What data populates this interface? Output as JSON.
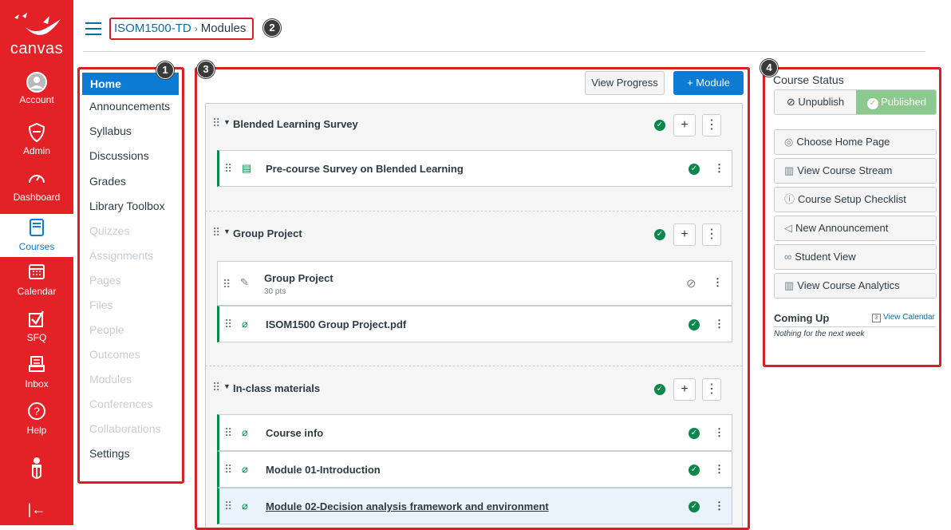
{
  "brand": {
    "wordmark": "canvas",
    "primary": "#e42127",
    "accent": "#0b7bd3",
    "published_green": "#0b874b"
  },
  "global_nav": [
    {
      "label": "Account",
      "icon": "account-avatar-icon"
    },
    {
      "label": "Admin",
      "icon": "shield-icon"
    },
    {
      "label": "Dashboard",
      "icon": "dashboard-gauge-icon"
    },
    {
      "label": "Courses",
      "icon": "courses-book-icon"
    },
    {
      "label": "Calendar",
      "icon": "calendar-icon"
    },
    {
      "label": "SFQ",
      "icon": "checkbox-icon"
    },
    {
      "label": "Inbox",
      "icon": "inbox-icon"
    },
    {
      "label": "Help",
      "icon": "help-icon"
    }
  ],
  "breadcrumb": {
    "course": "ISOM1500-TD",
    "sep": "›",
    "page": "Modules"
  },
  "callouts": [
    "1",
    "2",
    "3",
    "4"
  ],
  "course_nav": {
    "active": "Home",
    "items": [
      "Announcements",
      "Syllabus",
      "Discussions",
      "Grades",
      "Library Toolbox"
    ],
    "disabled": [
      "Quizzes",
      "Assignments",
      "Pages",
      "Files",
      "People",
      "Outcomes",
      "Modules",
      "Conferences",
      "Collaborations"
    ],
    "settings": "Settings"
  },
  "toolbar": {
    "view_progress": "View Progress",
    "add_module": "+ Module"
  },
  "modules": [
    {
      "title": "Blended Learning Survey",
      "items": [
        {
          "title": "Pre-course Survey on Blended Learning"
        }
      ]
    },
    {
      "title": "Group Project",
      "items": [
        {
          "title": "Group Project",
          "sub": "30 pts"
        },
        {
          "title": "ISOM1500 Group Project.pdf"
        }
      ]
    },
    {
      "title": "In-class materials",
      "items": [
        {
          "title": "Course info"
        },
        {
          "title": "Module 01-Introduction"
        },
        {
          "title": "Module 02-Decision analysis framework and environment"
        }
      ]
    }
  ],
  "sidebar": {
    "title": "Course Status",
    "unpublish": "Unpublish",
    "published": "Published",
    "buttons": [
      "Choose Home Page",
      "View Course Stream",
      "Course Setup Checklist",
      "New Announcement",
      "Student View",
      "View Course Analytics"
    ],
    "coming_up": "Coming Up",
    "view_calendar": "View Calendar",
    "calendar_day": "3",
    "nothing": "Nothing for the next week"
  }
}
